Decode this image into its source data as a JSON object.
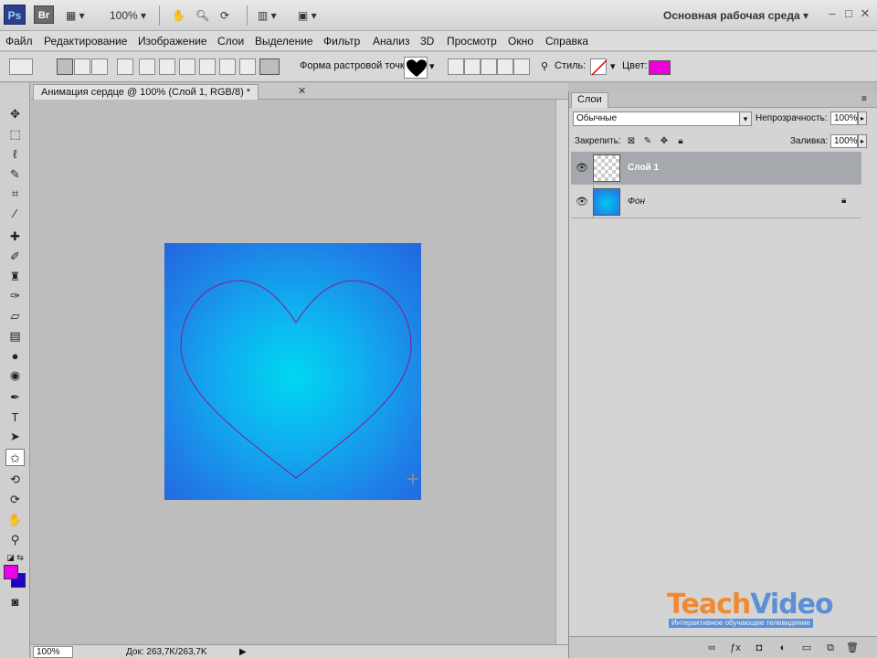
{
  "appbar": {
    "ps_logo": "Ps",
    "br_logo": "Br",
    "zoom": "100%",
    "workspace": "Основная рабочая среда"
  },
  "menu": [
    "Файл",
    "Редактирование",
    "Изображение",
    "Слои",
    "Выделение",
    "Фильтр",
    "Анализ",
    "3D",
    "Просмотр",
    "Окно",
    "Справка"
  ],
  "options": {
    "shape_label": "Форма растровой точки:",
    "style_label": "Стиль:",
    "color_label": "Цвет:",
    "color_value": "#ee00dd"
  },
  "document": {
    "tab_title": "Анимация сердце @ 100% (Слой 1, RGB/8) *",
    "zoom": "100%",
    "doc_size": "Док: 263,7K/263,7K"
  },
  "toolbox": {
    "foreground": "#ee00ee",
    "background": "#2200cc"
  },
  "layers_panel": {
    "tab": "Слои",
    "blend_mode": "Обычные",
    "opacity_label": "Непрозрачность:",
    "opacity_value": "100%",
    "lock_label": "Закрепить:",
    "fill_label": "Заливка:",
    "fill_value": "100%",
    "layers": [
      {
        "name": "Слой 1",
        "selected": true,
        "visible": true
      },
      {
        "name": "Фон",
        "selected": false,
        "visible": true,
        "locked": true
      }
    ]
  },
  "watermark": {
    "teach": "Teach",
    "video": "Video",
    "subtitle": "Интерактивное обучающее телевидение"
  }
}
